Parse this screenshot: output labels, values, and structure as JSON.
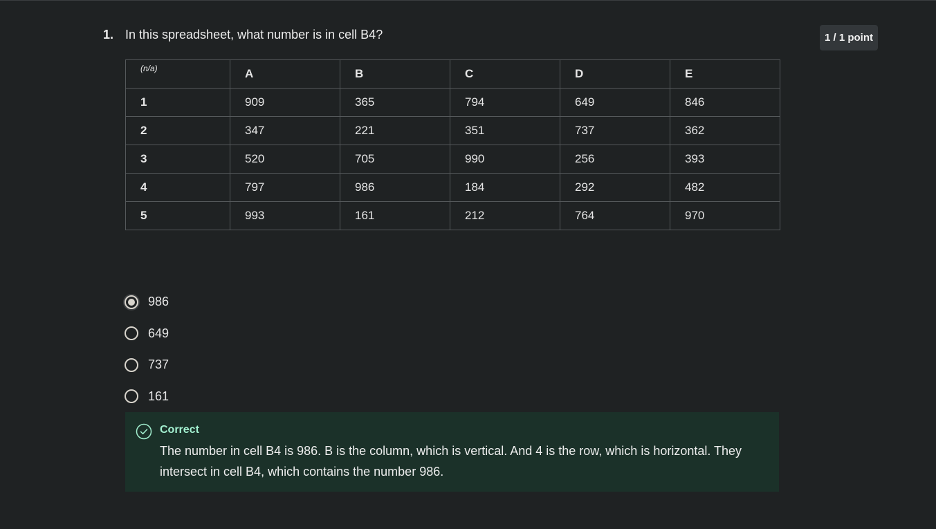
{
  "question": {
    "number": "1.",
    "text": "In this spreadsheet, what number is in cell B4?"
  },
  "score": {
    "label": "1 / 1 point"
  },
  "spreadsheet": {
    "corner": "(n/a)",
    "columns": [
      "A",
      "B",
      "C",
      "D",
      "E"
    ],
    "rows": [
      {
        "header": "1",
        "cells": [
          "909",
          "365",
          "794",
          "649",
          "846"
        ]
      },
      {
        "header": "2",
        "cells": [
          "347",
          "221",
          "351",
          "737",
          "362"
        ]
      },
      {
        "header": "3",
        "cells": [
          "520",
          "705",
          "990",
          "256",
          "393"
        ]
      },
      {
        "header": "4",
        "cells": [
          "797",
          "986",
          "184",
          "292",
          "482"
        ]
      },
      {
        "header": "5",
        "cells": [
          "993",
          "161",
          "212",
          "764",
          "970"
        ]
      }
    ]
  },
  "options": [
    {
      "label": "986",
      "selected": true
    },
    {
      "label": "649",
      "selected": false
    },
    {
      "label": "737",
      "selected": false
    },
    {
      "label": "161",
      "selected": false
    }
  ],
  "feedback": {
    "status": "Correct",
    "icon": "check-circle-icon",
    "text": "The number in cell B4 is 986. B is the column, which is vertical. And 4 is the row, which is horizontal. They intersect in cell B4, which contains the number 986."
  },
  "colors": {
    "background": "#1f2223",
    "feedback_background": "#1b3129",
    "feedback_accent": "#a3f0d0",
    "badge_background": "#33373a"
  }
}
